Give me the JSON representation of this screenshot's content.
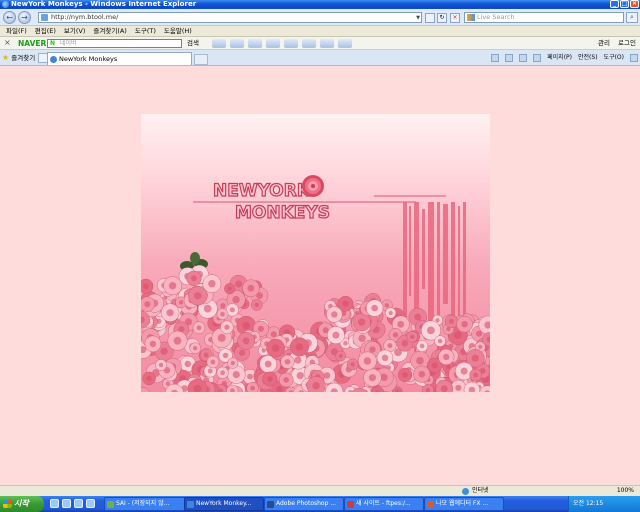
{
  "window": {
    "title": "NewYork Monkeys - Windows Internet Explorer",
    "minimize": "_",
    "maximize": "□",
    "close": "×"
  },
  "address_bar": {
    "url": "http://nym.btool.me/",
    "back": "←",
    "forward": "→",
    "search_placeholder": "Live Search",
    "search_go": "⌕"
  },
  "menu": [
    "파일(F)",
    "편집(E)",
    "보기(V)",
    "즐겨찾기(A)",
    "도구(T)",
    "도움말(H)"
  ],
  "naver_toolbar": {
    "close": "×",
    "brand": "NAVER",
    "search_placeholder": "네이버",
    "search_label": "검색",
    "manage_label": "관리",
    "login_label": "로그인"
  },
  "tabs": {
    "favorites_label": "즐겨찾기",
    "active_tab": "NewYork Monkeys",
    "commands": [
      "페이지(P)",
      "안전(S)",
      "도구(O)"
    ]
  },
  "banner": {
    "logo_line1": "NEWYORK",
    "logo_line2": "MONKEYS",
    "colors": {
      "logo_fill": "#f9c6cf",
      "logo_stroke": "#c53d5a",
      "rose": "#e85f78",
      "stripe": "#e8677f",
      "background_top": "#fff1f1",
      "background_bottom": "#f38aa2"
    }
  },
  "statusbar": {
    "zone": "인터넷",
    "zoom": "100%"
  },
  "taskbar": {
    "start_label": "시작",
    "items": [
      {
        "label": "SAI - (저장되지 않...",
        "color": "#6fb23a"
      },
      {
        "label": "NewYork Monkey...",
        "color": "#3e86d8"
      },
      {
        "label": "Adobe Photoshop ...",
        "color": "#2a4b8f"
      },
      {
        "label": "새 사이트 - ftpes:/...",
        "color": "#d23b3b"
      },
      {
        "label": "나모 웹에디터 FX ...",
        "color": "#e0572c"
      }
    ],
    "clock": "오전 12:15"
  }
}
